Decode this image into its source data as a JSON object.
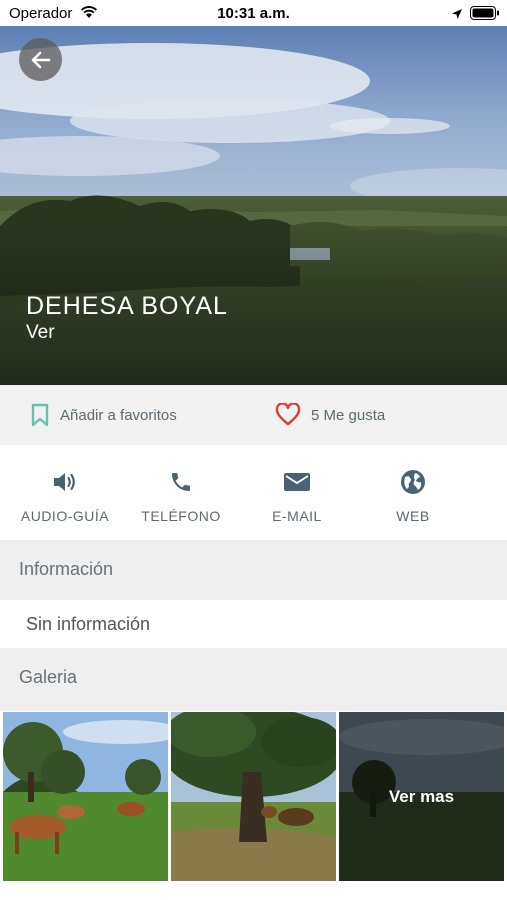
{
  "status_bar": {
    "carrier": "Operador",
    "time": "10:31 a.m."
  },
  "hero": {
    "title": "DEHESA BOYAL",
    "subtitle": "Ver"
  },
  "actions_bar": {
    "favorite_label": "Añadir a favoritos",
    "likes_label": "5 Me gusta"
  },
  "contact_actions": [
    {
      "label": "AUDIO-GUÍA",
      "icon": "speaker-icon"
    },
    {
      "label": "TELÉFONO",
      "icon": "phone-icon"
    },
    {
      "label": "E-MAIL",
      "icon": "mail-icon"
    },
    {
      "label": "WEB",
      "icon": "globe-icon"
    }
  ],
  "info_section": {
    "header": "Información",
    "content": "Sin información"
  },
  "gallery_section": {
    "header": "Galeria",
    "more_label": "Ver mas"
  },
  "colors": {
    "icon_blue": "#4a6373",
    "bookmark_teal": "#66c2b0",
    "heart_red": "#e53935",
    "section_bg": "#efefef"
  }
}
